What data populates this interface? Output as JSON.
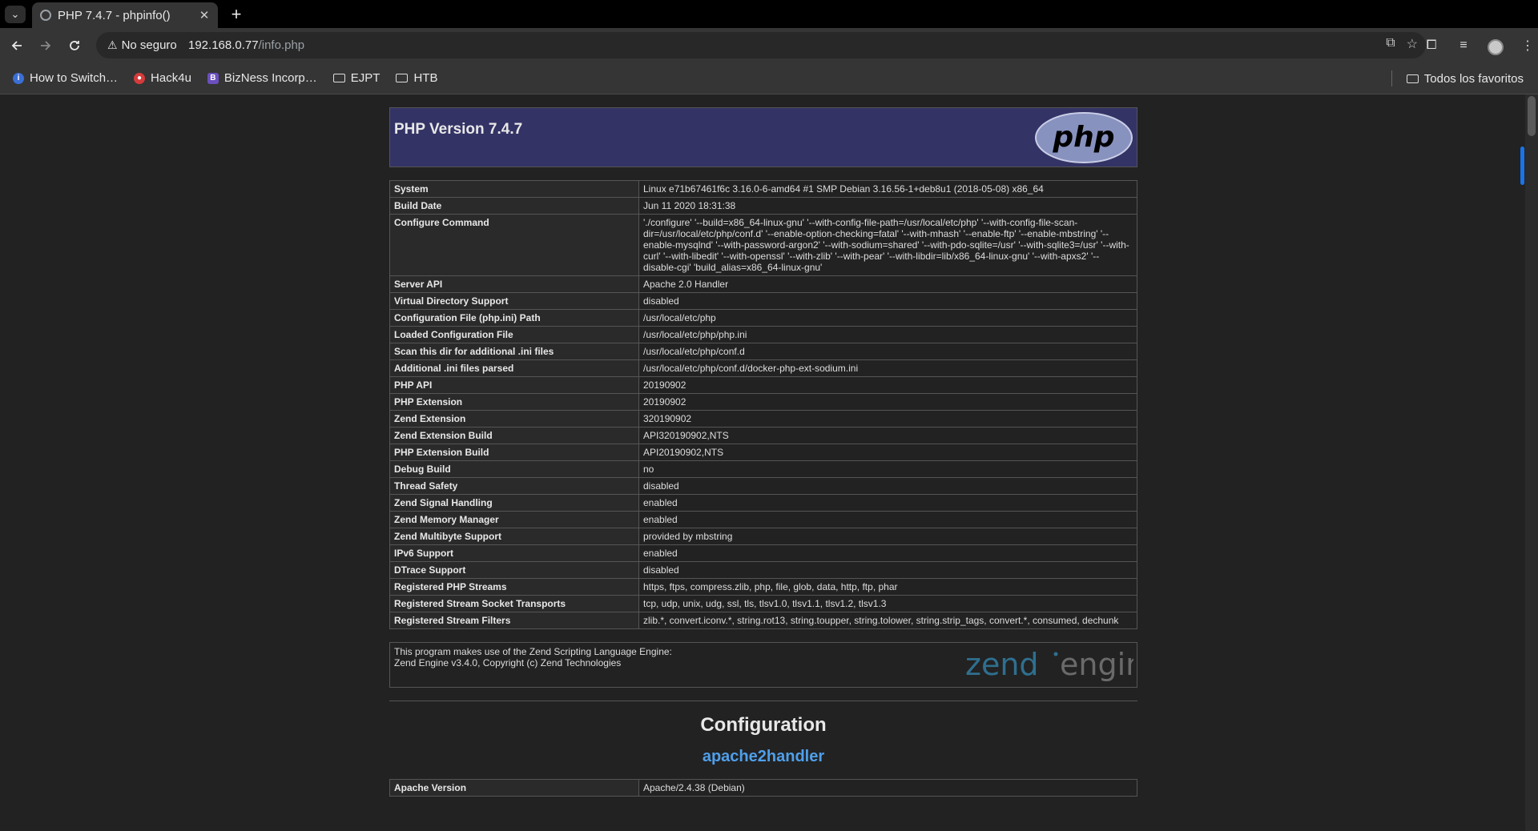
{
  "browser": {
    "tab": {
      "title": "PHP 7.4.7 - phpinfo()"
    },
    "address": {
      "security_label": "No seguro",
      "host": "192.168.0.77",
      "path": "/info.php"
    },
    "bookmarks": [
      {
        "label": "How to Switch…",
        "icon": "bookmark-favicon",
        "color": "#3b6fd6"
      },
      {
        "label": "Hack4u",
        "icon": "bookmark-favicon",
        "color": "#d63b3b"
      },
      {
        "label": "BizNess Incorp…",
        "icon": "bookmark-favicon",
        "color": "#6b4fbf"
      },
      {
        "label": "EJPT",
        "icon": "folder-icon"
      },
      {
        "label": "HTB",
        "icon": "folder-icon"
      }
    ],
    "all_bookmarks_label": "Todos los favoritos"
  },
  "page": {
    "header_title": "PHP Version 7.4.7",
    "php_logo_text": "php",
    "info_rows": [
      {
        "key": "System",
        "value": "Linux e71b67461f6c 3.16.0-6-amd64 #1 SMP Debian 3.16.56-1+deb8u1 (2018-05-08) x86_64"
      },
      {
        "key": "Build Date",
        "value": "Jun 11 2020 18:31:38"
      },
      {
        "key": "Configure Command",
        "value": "'./configure' '--build=x86_64-linux-gnu' '--with-config-file-path=/usr/local/etc/php' '--with-config-file-scan-dir=/usr/local/etc/php/conf.d' '--enable-option-checking=fatal' '--with-mhash' '--enable-ftp' '--enable-mbstring' '--enable-mysqlnd' '--with-password-argon2' '--with-sodium=shared' '--with-pdo-sqlite=/usr' '--with-sqlite3=/usr' '--with-curl' '--with-libedit' '--with-openssl' '--with-zlib' '--with-pear' '--with-libdir=lib/x86_64-linux-gnu' '--with-apxs2' '--disable-cgi' 'build_alias=x86_64-linux-gnu'"
      },
      {
        "key": "Server API",
        "value": "Apache 2.0 Handler"
      },
      {
        "key": "Virtual Directory Support",
        "value": "disabled"
      },
      {
        "key": "Configuration File (php.ini) Path",
        "value": "/usr/local/etc/php"
      },
      {
        "key": "Loaded Configuration File",
        "value": "/usr/local/etc/php/php.ini"
      },
      {
        "key": "Scan this dir for additional .ini files",
        "value": "/usr/local/etc/php/conf.d"
      },
      {
        "key": "Additional .ini files parsed",
        "value": "/usr/local/etc/php/conf.d/docker-php-ext-sodium.ini"
      },
      {
        "key": "PHP API",
        "value": "20190902"
      },
      {
        "key": "PHP Extension",
        "value": "20190902"
      },
      {
        "key": "Zend Extension",
        "value": "320190902"
      },
      {
        "key": "Zend Extension Build",
        "value": "API320190902,NTS"
      },
      {
        "key": "PHP Extension Build",
        "value": "API20190902,NTS"
      },
      {
        "key": "Debug Build",
        "value": "no"
      },
      {
        "key": "Thread Safety",
        "value": "disabled"
      },
      {
        "key": "Zend Signal Handling",
        "value": "enabled"
      },
      {
        "key": "Zend Memory Manager",
        "value": "enabled"
      },
      {
        "key": "Zend Multibyte Support",
        "value": "provided by mbstring"
      },
      {
        "key": "IPv6 Support",
        "value": "enabled"
      },
      {
        "key": "DTrace Support",
        "value": "disabled"
      },
      {
        "key": "Registered PHP Streams",
        "value": "https, ftps, compress.zlib, php, file, glob, data, http, ftp, phar"
      },
      {
        "key": "Registered Stream Socket Transports",
        "value": "tcp, udp, unix, udg, ssl, tls, tlsv1.0, tlsv1.1, tlsv1.2, tlsv1.3"
      },
      {
        "key": "Registered Stream Filters",
        "value": "zlib.*, convert.iconv.*, string.rot13, string.toupper, string.tolower, string.strip_tags, convert.*, consumed, dechunk"
      }
    ],
    "zend_text_line1": "This program makes use of the Zend Scripting Language Engine:",
    "zend_text_line2": "Zend Engine v3.4.0, Copyright (c) Zend Technologies",
    "zend_logo_text": {
      "word1": "zend",
      "word2": "engine"
    },
    "configuration_heading": "Configuration",
    "module_heading": "apache2handler",
    "module_rows": [
      {
        "key": "Apache Version",
        "value": "Apache/2.4.38 (Debian)"
      }
    ]
  },
  "colors": {
    "php_header_bg": "#333366",
    "module_link": "#4f9fea",
    "page_bg": "#222222"
  }
}
